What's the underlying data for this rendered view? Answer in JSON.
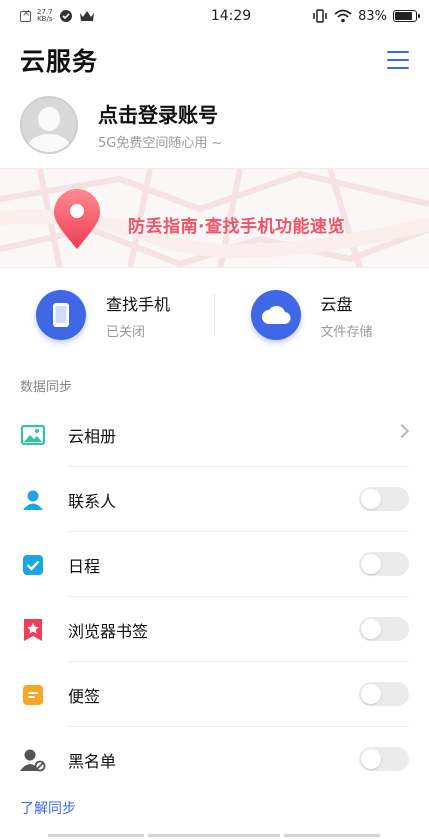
{
  "status_bar": {
    "net_speed_value": "27.7",
    "net_speed_unit": "KB/s",
    "time": "14:29",
    "battery_percent": "83%",
    "battery_level": 0.83
  },
  "header": {
    "title": "云服务",
    "menu_icon": "list-menu-icon"
  },
  "account": {
    "title": "点击登录账号",
    "subtitle": "5G免费空间随心用 ~"
  },
  "banner": {
    "text": "防丢指南·查找手机功能速览",
    "icon": "location-pin-icon"
  },
  "quick": [
    {
      "title": "查找手机",
      "subtitle": "已关闭",
      "icon": "phone-icon"
    },
    {
      "title": "云盘",
      "subtitle": "文件存储",
      "icon": "cloud-icon"
    }
  ],
  "section_label": "数据同步",
  "sync_items": [
    {
      "label": "云相册",
      "icon": "album-icon",
      "control": "chevron"
    },
    {
      "label": "联系人",
      "icon": "contact-icon",
      "control": "toggle",
      "on": false
    },
    {
      "label": "日程",
      "icon": "calendar-check-icon",
      "control": "toggle",
      "on": false
    },
    {
      "label": "浏览器书签",
      "icon": "bookmark-icon",
      "control": "toggle",
      "on": false
    },
    {
      "label": "便签",
      "icon": "note-icon",
      "control": "toggle",
      "on": false
    },
    {
      "label": "黑名单",
      "icon": "blacklist-icon",
      "control": "toggle",
      "on": false
    }
  ],
  "learn_link": "了解同步",
  "colors": {
    "accent": "#3d6ae8",
    "banner_text": "#f0546a",
    "album_icon": "#2fc6a0",
    "contact_icon": "#1aa6e4",
    "calendar_icon": "#1aa6e4",
    "bookmark_icon": "#ee3f5c",
    "note_icon": "#f5a623",
    "blacklist_icon": "#555555"
  }
}
